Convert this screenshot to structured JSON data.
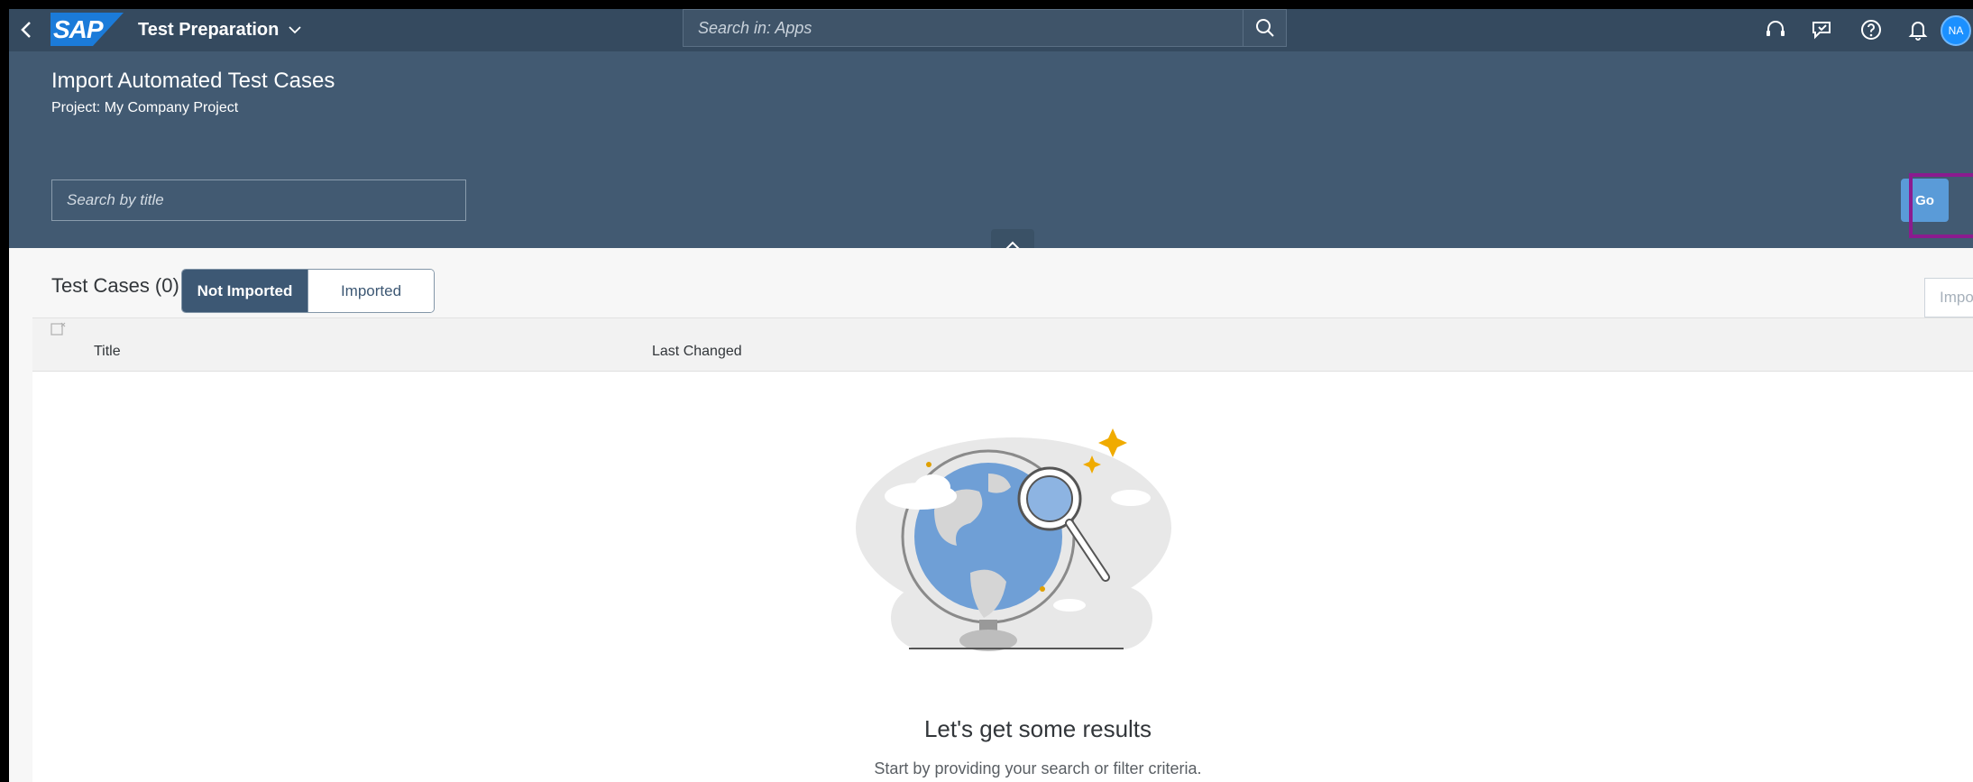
{
  "shell": {
    "app_title": "Test Preparation",
    "search_placeholder": "Search in: Apps",
    "avatar_initials": "NA",
    "logo_text": "SAP"
  },
  "header": {
    "title": "Import Automated Test Cases",
    "subtitle": "Project: My Company Project",
    "filter_placeholder": "Search by title",
    "go_label": "Go"
  },
  "table": {
    "title": "Test Cases (0)",
    "segments": [
      "Not Imported",
      "Imported"
    ],
    "selected_segment": "Not Imported",
    "import_label": "Import",
    "columns": [
      "Title",
      "Last Changed"
    ]
  },
  "empty_state": {
    "title": "Let's get some results",
    "subtitle": "Start by providing your search or filter criteria."
  },
  "colors": {
    "shell": "#354a5f",
    "header": "#425a72",
    "accent": "#5a9bd8",
    "highlight": "#8b1b8f"
  }
}
